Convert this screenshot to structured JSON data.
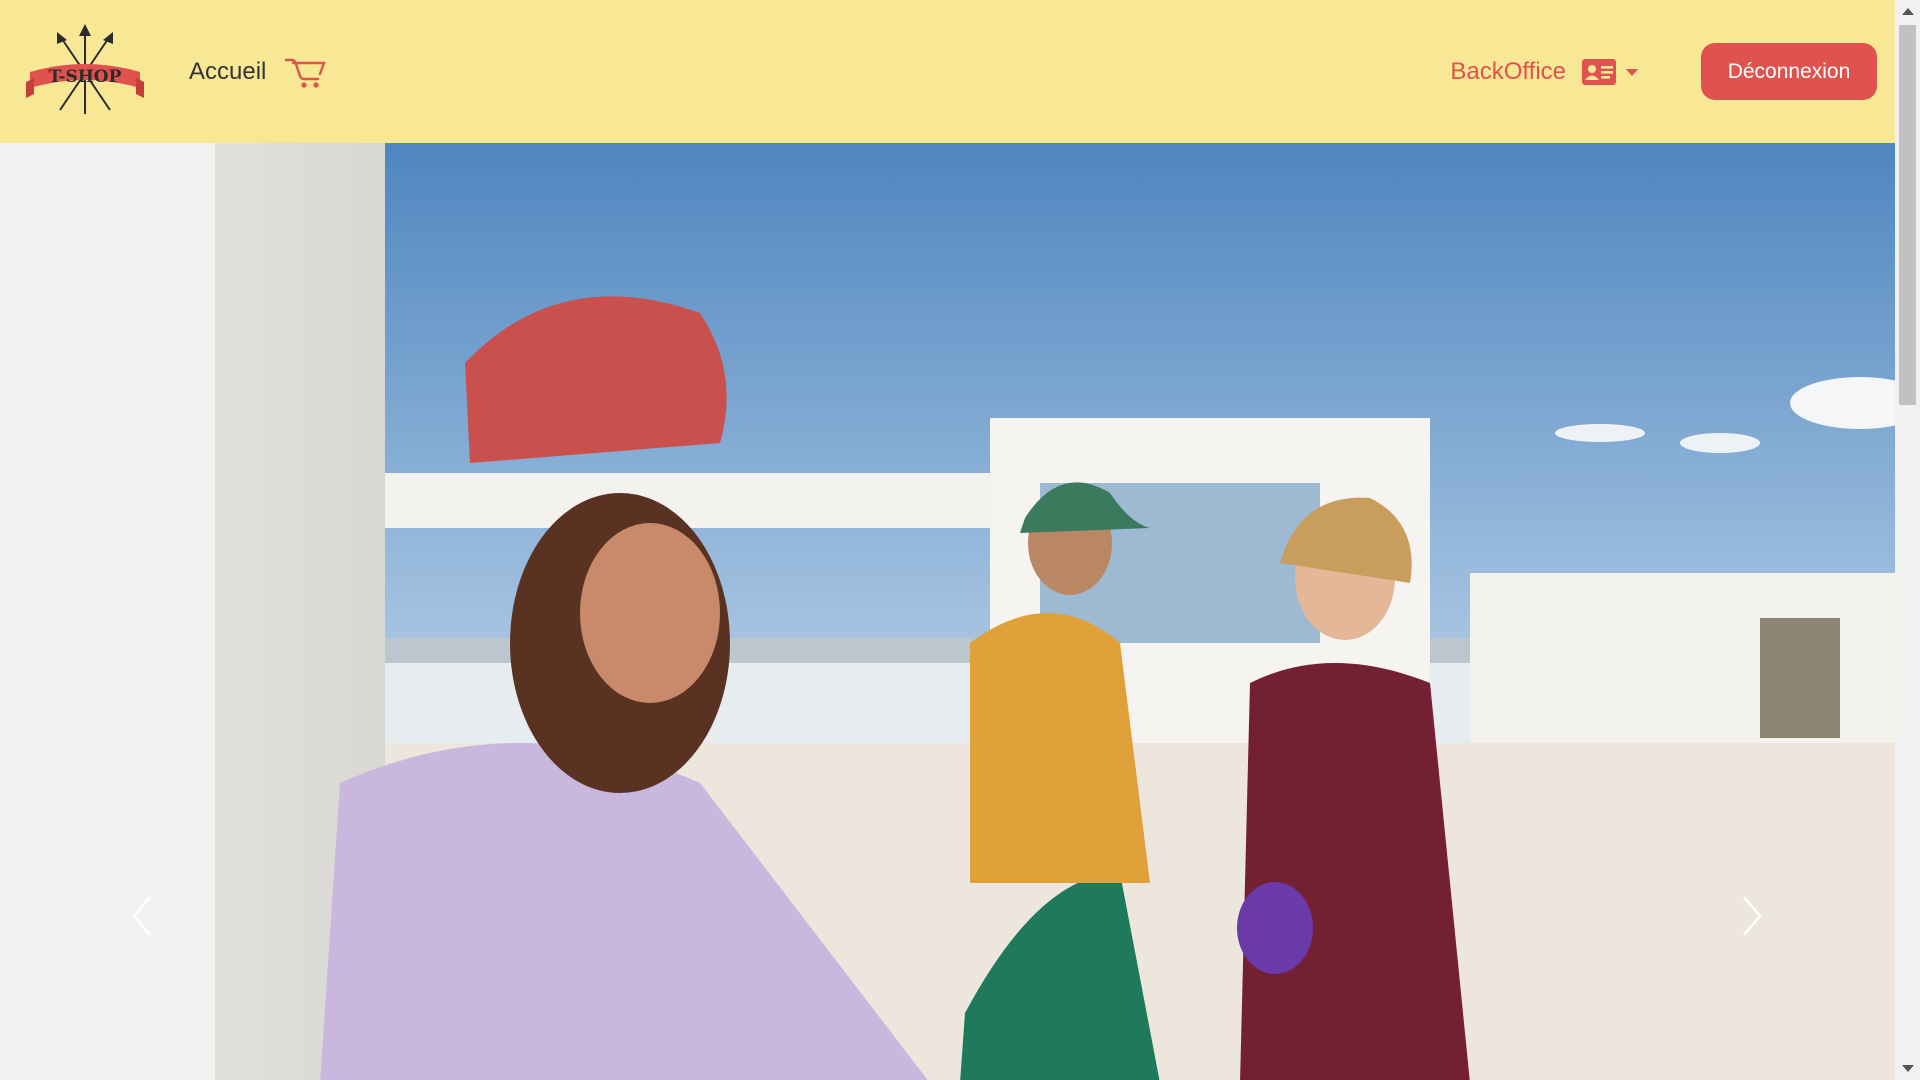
{
  "colors": {
    "navbar_bg": "#f8e896",
    "accent": "#e0524e",
    "text": "#333333",
    "button_text": "#ffffff"
  },
  "navbar": {
    "logo_text": "T-SHOP",
    "home_label": "Accueil",
    "cart_icon": "cart-icon",
    "backoffice_label": "BackOffice",
    "profile_icon": "id-card-icon",
    "profile_dropdown_icon": "caret-down-icon",
    "logout_label": "Déconnexion"
  },
  "carousel": {
    "prev_icon": "chevron-left-icon",
    "next_icon": "chevron-right-icon"
  }
}
